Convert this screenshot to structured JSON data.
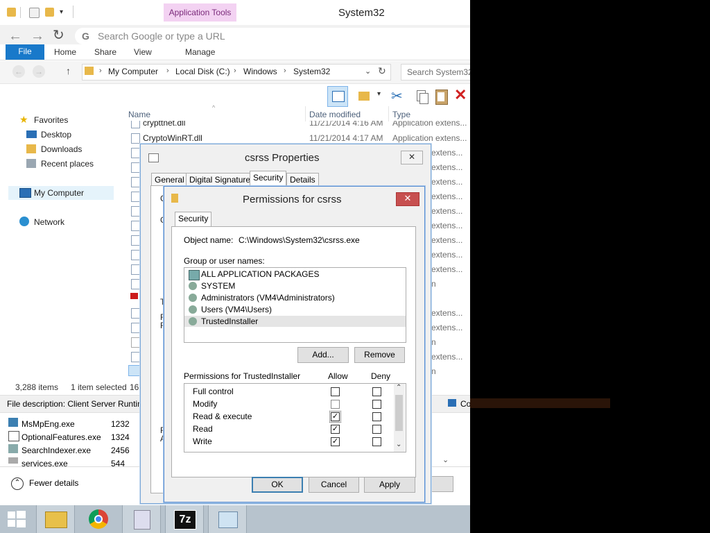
{
  "window": {
    "app_tools_label": "Application Tools",
    "title": "System32"
  },
  "browser_ghost": {
    "search_placeholder": "Search Google or type a URL"
  },
  "ribbon": {
    "file_tab": "File",
    "tabs": [
      "Home",
      "Share",
      "View",
      "Manage"
    ]
  },
  "address": {
    "crumbs": [
      "My Computer",
      "Local Disk (C:)",
      "Windows",
      "System32"
    ],
    "search_placeholder": "Search System32"
  },
  "nav": {
    "favorites": "Favorites",
    "desktop": "Desktop",
    "downloads": "Downloads",
    "recent": "Recent places",
    "my_computer": "My Computer",
    "network": "Network"
  },
  "columns": {
    "name": "Name",
    "date": "Date modified",
    "type": "Type"
  },
  "files": [
    {
      "name": "crypttnet.dll",
      "date": "11/21/2014 4:16 AM",
      "type": "Application extens..."
    },
    {
      "name": "CryptoWinRT.dll",
      "date": "11/21/2014 4:17 AM",
      "type": "Application extens..."
    }
  ],
  "right_col_fragments": [
    "extens...",
    "extens...",
    "extens...",
    "extens...",
    "extens...",
    "extens...",
    "extens...",
    "extens...",
    "extens...",
    "n",
    "extens...",
    "extens...",
    "n",
    "extens...",
    "n"
  ],
  "status": {
    "items": "3,288 items",
    "selected": "1 item selected",
    "size_fragment": "16."
  },
  "file_description": "File description: Client Server Runtim",
  "file_desc_right": "Co",
  "props_left_fragments": [
    "C",
    "G",
    "T",
    "F",
    "F",
    "F",
    "A"
  ],
  "processes": [
    {
      "name": "MsMpEng.exe",
      "pid": "1232"
    },
    {
      "name": "OptionalFeatures.exe",
      "pid": "1324"
    },
    {
      "name": "SearchIndexer.exe",
      "pid": "2456"
    },
    {
      "name": "services.exe",
      "pid": "544"
    }
  ],
  "fewer_details": "Fewer details",
  "properties": {
    "title": "csrss Properties",
    "close": "✕",
    "tabs": [
      "General",
      "Digital Signatures",
      "Security",
      "Details"
    ],
    "active_tab": "Security"
  },
  "permissions": {
    "title": "Permissions for csrss",
    "close": "✕",
    "tab": "Security",
    "object_label": "Object name:",
    "object_value": "C:\\Windows\\System32\\csrss.exe",
    "group_label": "Group or user names:",
    "users": [
      "ALL APPLICATION PACKAGES",
      "SYSTEM",
      "Administrators (VM4\\Administrators)",
      "Users (VM4\\Users)",
      "TrustedInstaller"
    ],
    "selected_user": "TrustedInstaller",
    "add_button": "Add...",
    "remove_button": "Remove",
    "perm_header": "Permissions for TrustedInstaller",
    "allow": "Allow",
    "deny": "Deny",
    "rows": [
      {
        "name": "Full control",
        "allow": false,
        "deny": false
      },
      {
        "name": "Modify",
        "allow": false,
        "deny": false
      },
      {
        "name": "Read & execute",
        "allow": true,
        "deny": false
      },
      {
        "name": "Read",
        "allow": true,
        "deny": false
      },
      {
        "name": "Write",
        "allow": true,
        "deny": false
      }
    ],
    "ok": "OK",
    "cancel": "Cancel",
    "apply": "Apply"
  },
  "taskbar": {
    "sevenzip_label": "7z"
  }
}
